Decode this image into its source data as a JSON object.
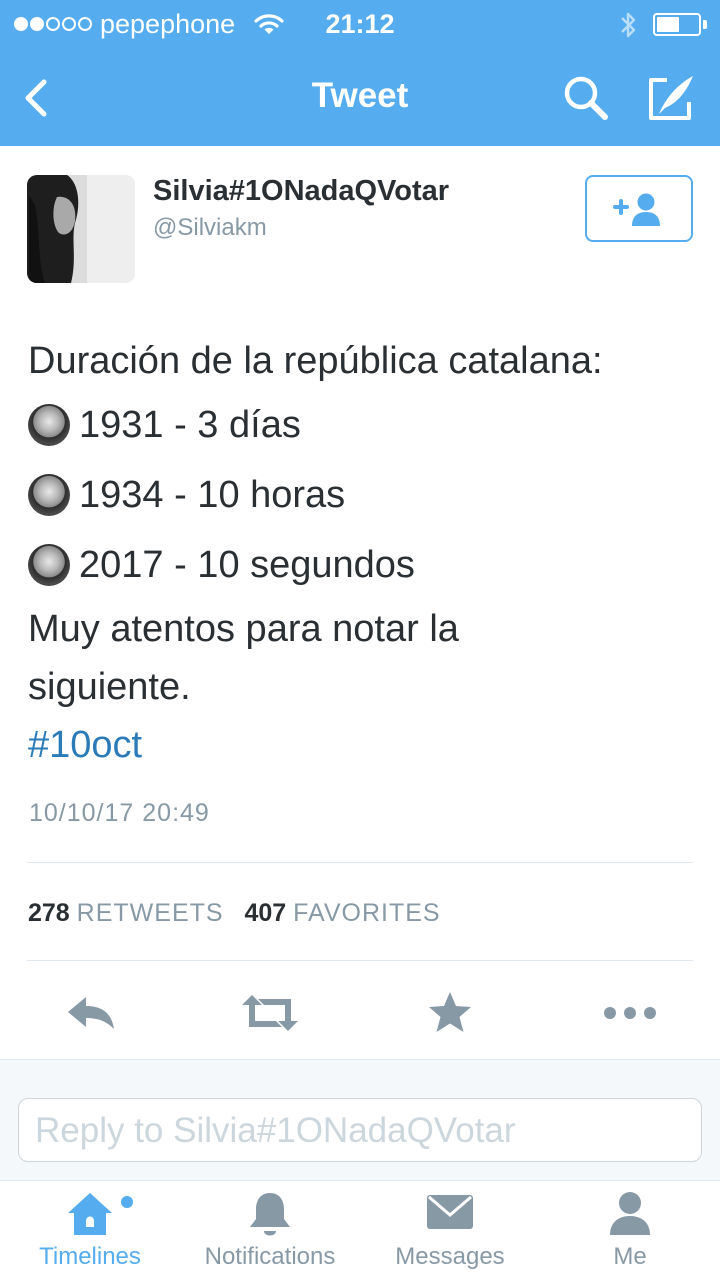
{
  "status_bar": {
    "carrier": "pepephone",
    "time": "21:12",
    "signal_bars_filled": 2,
    "signal_bars_total": 5,
    "battery_level": 0.55
  },
  "nav": {
    "title": "Tweet",
    "icons": [
      "chevron-left-icon",
      "search-icon",
      "compose-icon"
    ]
  },
  "tweet": {
    "author": {
      "name": "Silvia#1ONadaQVotar",
      "handle": "@Silviakm"
    },
    "lines": {
      "intro": "Duración de la república catalana:",
      "item1": "1931 - 3 días",
      "item2": "1934 - 10 horas",
      "item3": "2017 - 10 segundos",
      "outro1": "Muy atentos para notar la",
      "outro2": "siguiente.",
      "hashtag": "#10oct"
    },
    "timestamp": "10/10/17 20:49",
    "stats": {
      "retweets_count": "278",
      "retweets_label": "RETWEETS",
      "favorites_count": "407",
      "favorites_label": "FAVORITES"
    },
    "actions": [
      "reply-icon",
      "retweet-icon",
      "favorite-star-icon",
      "more-icon"
    ]
  },
  "reply": {
    "placeholder": "Reply to Silvia#1ONadaQVotar"
  },
  "tabs": [
    {
      "label": "Timelines",
      "icon": "home-icon",
      "active": true
    },
    {
      "label": "Notifications",
      "icon": "bell-icon",
      "active": false
    },
    {
      "label": "Messages",
      "icon": "envelope-icon",
      "active": false
    },
    {
      "label": "Me",
      "icon": "person-icon",
      "active": false
    }
  ],
  "colors": {
    "brand_blue": "#55acee",
    "link_blue": "#2b7bb9",
    "text_dark": "#292f33",
    "text_gray": "#8899a6",
    "icon_gray": "#8899a6"
  }
}
